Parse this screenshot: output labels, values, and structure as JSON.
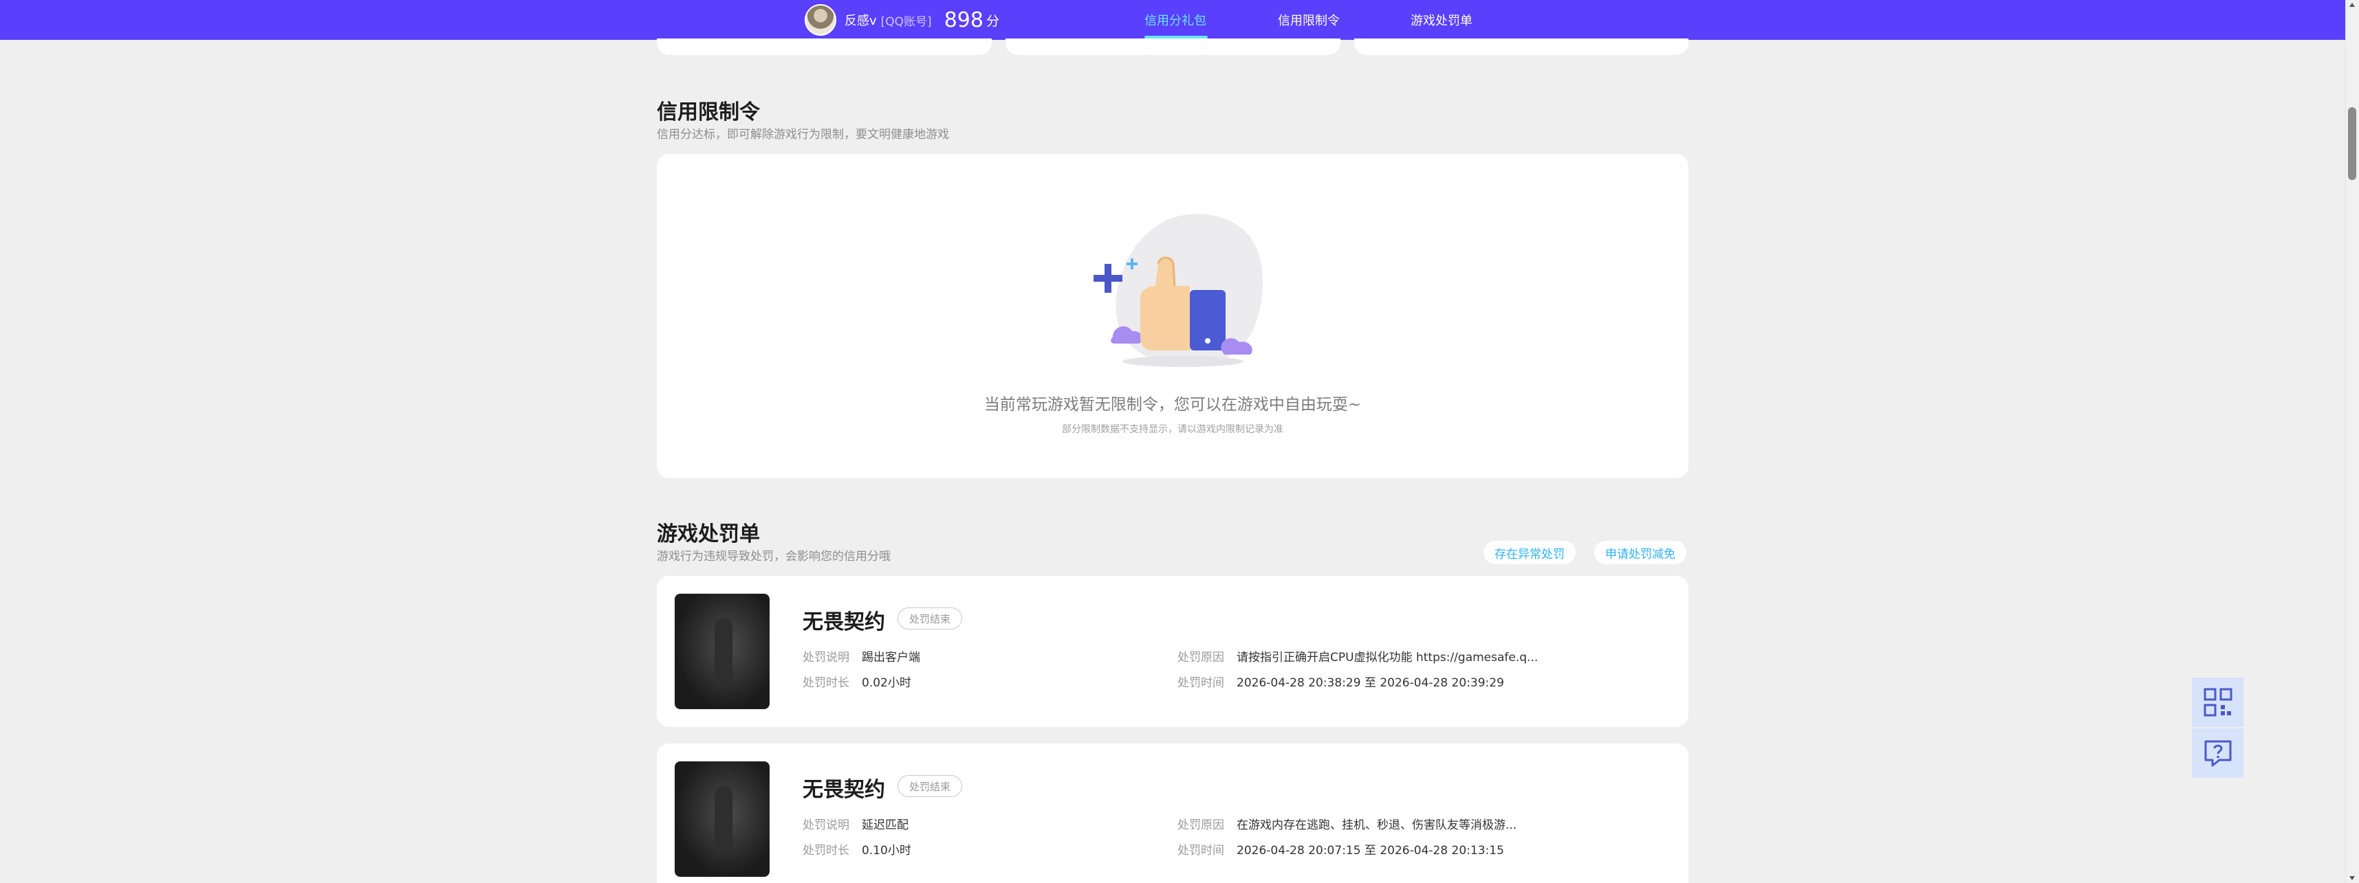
{
  "header": {
    "username": "反感v",
    "account_tag": "[QQ账号]",
    "score": "898",
    "score_unit": "分",
    "nav": [
      {
        "label": "信用分礼包"
      },
      {
        "label": "信用限制令"
      },
      {
        "label": "游戏处罚单"
      }
    ],
    "active_nav": "信用分礼包"
  },
  "restriction": {
    "title": "信用限制令",
    "subtitle": "信用分达标，即可解除游戏行为限制，要文明健康地游戏",
    "empty_main": "当前常玩游戏暂无限制令，您可以在游戏中自由玩耍~",
    "empty_sub": "部分限制数据不支持显示，请以游戏内限制记录为准"
  },
  "penalty": {
    "title": "游戏处罚单",
    "subtitle": "游戏行为违规导致处罚，会影响您的信用分哦",
    "buttons": {
      "abnormal": "存在异常处罚",
      "reduce": "申请处罚减免"
    },
    "items": [
      {
        "game": "无畏契约",
        "status": "处罚结束",
        "desc_label": "处罚说明",
        "desc": "踢出客户端",
        "duration_label": "处罚时长",
        "duration": "0.02小时",
        "reason_label": "处罚原因",
        "reason": "请按指引正确开启CPU虚拟化功能 https://gamesafe.q...",
        "time_label": "处罚时间",
        "time": "2026-04-28 20:38:29 至 2026-04-28 20:39:29"
      },
      {
        "game": "无畏契约",
        "status": "处罚结束",
        "desc_label": "处罚说明",
        "desc": "延迟匹配",
        "duration_label": "处罚时长",
        "duration": "0.10小时",
        "reason_label": "处罚原因",
        "reason": "在游戏内存在逃跑、挂机、秒退、伤害队友等消极游...",
        "time_label": "处罚时间",
        "time": "2026-04-28 20:07:15 至 2026-04-28 20:13:15"
      }
    ]
  },
  "colors": {
    "brand": "#5a3ffd",
    "active_nav": "#68e6ff",
    "link": "#2fb3f5"
  },
  "icons": [
    "qr-code-icon",
    "help-chat-icon",
    "thumbs-up-illustration"
  ]
}
